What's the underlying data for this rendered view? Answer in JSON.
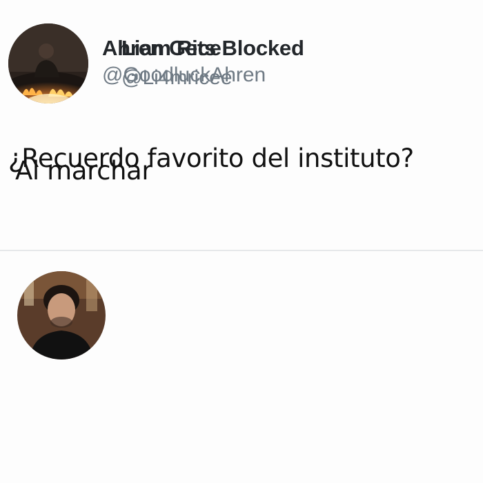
{
  "tweets": [
    {
      "display_name": "Ahren Gets Blocked",
      "handle": "@GoodluckAhren",
      "text": "¿Recuerdo favorito del instituto?",
      "avatar_icon": "avatar-photo-person-with-fire"
    },
    {
      "display_name": "Liam Rice",
      "handle": "@Li4mricee",
      "text": "Al marchar",
      "avatar_icon": "avatar-photo-person-portrait"
    }
  ],
  "colors": {
    "display_name": "#23272b",
    "handle": "#6f7a84",
    "text": "#111111",
    "divider": "#e6e8ea"
  }
}
